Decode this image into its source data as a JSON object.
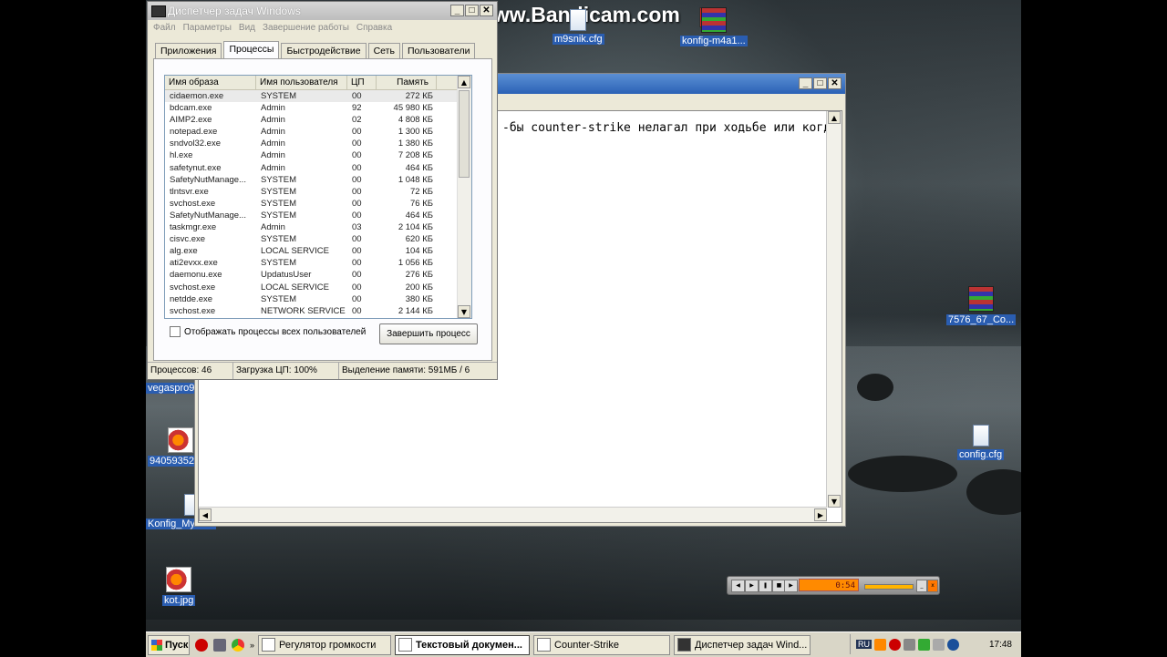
{
  "watermark": {
    "text": "www.Bandicam.com"
  },
  "desktop_icons": {
    "m9snik": "m9snik.cfg",
    "konfig_m4a1": "konfig-m4a1...",
    "rar7576": "7576_67_Co...",
    "config": "config.cfg",
    "vegaspro": "vegaspro9",
    "num_img": "94059352",
    "konfig_myas": "Konfig_Myas...",
    "kot": "kot.jpg"
  },
  "notepad": {
    "text": "-бы counter-strike нелагал при ходьбе или когда",
    "buttons": {
      "minimize": "_",
      "maximize": "□",
      "close": "✕"
    }
  },
  "taskmgr": {
    "title": "Диспетчер задач Windows",
    "menu": [
      "Файл",
      "Параметры",
      "Вид",
      "Завершение работы",
      "Справка"
    ],
    "tabs": [
      "Приложения",
      "Процессы",
      "Быстродействие",
      "Сеть",
      "Пользователи"
    ],
    "columns": [
      "Имя образа",
      "Имя пользователя",
      "ЦП",
      "Память"
    ],
    "rows": [
      [
        "cidaemon.exe",
        "SYSTEM",
        "00",
        "272 КБ"
      ],
      [
        "bdcam.exe",
        "Admin",
        "92",
        "45 980 КБ"
      ],
      [
        "AIMP2.exe",
        "Admin",
        "02",
        "4 808 КБ"
      ],
      [
        "notepad.exe",
        "Admin",
        "00",
        "1 300 КБ"
      ],
      [
        "sndvol32.exe",
        "Admin",
        "00",
        "1 380 КБ"
      ],
      [
        "hl.exe",
        "Admin",
        "00",
        "7 208 КБ"
      ],
      [
        "safetynut.exe",
        "Admin",
        "00",
        "464 КБ"
      ],
      [
        "SafetyNutManage...",
        "SYSTEM",
        "00",
        "1 048 КБ"
      ],
      [
        "tlntsvr.exe",
        "SYSTEM",
        "00",
        "72 КБ"
      ],
      [
        "svchost.exe",
        "SYSTEM",
        "00",
        "76 КБ"
      ],
      [
        "SafetyNutManage...",
        "SYSTEM",
        "00",
        "464 КБ"
      ],
      [
        "taskmgr.exe",
        "Admin",
        "03",
        "2 104 КБ"
      ],
      [
        "cisvc.exe",
        "SYSTEM",
        "00",
        "620 КБ"
      ],
      [
        "alg.exe",
        "LOCAL SERVICE",
        "00",
        "104 КБ"
      ],
      [
        "ati2evxx.exe",
        "SYSTEM",
        "00",
        "1 056 КБ"
      ],
      [
        "daemonu.exe",
        "UpdatusUser",
        "00",
        "276 КБ"
      ],
      [
        "svchost.exe",
        "LOCAL SERVICE",
        "00",
        "200 КБ"
      ],
      [
        "netdde.exe",
        "SYSTEM",
        "00",
        "380 КБ"
      ],
      [
        "svchost.exe",
        "NETWORK SERVICE",
        "00",
        "2 144 КБ"
      ]
    ],
    "show_all_label": "Отображать процессы всех пользователей",
    "end_process_label": "Завершить процесс",
    "status": {
      "processes": "Процессов: 46",
      "cpu": "Загрузка ЦП: 100%",
      "memory": "Выделение памяти: 591МБ / 6"
    }
  },
  "player": {
    "time": "0:54"
  },
  "taskbar": {
    "start": "Пуск",
    "items": [
      {
        "label": "Регулятор громкости",
        "icon": "volume-icon"
      },
      {
        "label": "Текстовый докумен...",
        "icon": "notepad-icon"
      },
      {
        "label": "Counter-Strike",
        "icon": "cs-icon"
      },
      {
        "label": "Диспетчер задач Wind...",
        "icon": "taskmgr-icon"
      }
    ],
    "lang": "RU",
    "clock": "17:48"
  }
}
